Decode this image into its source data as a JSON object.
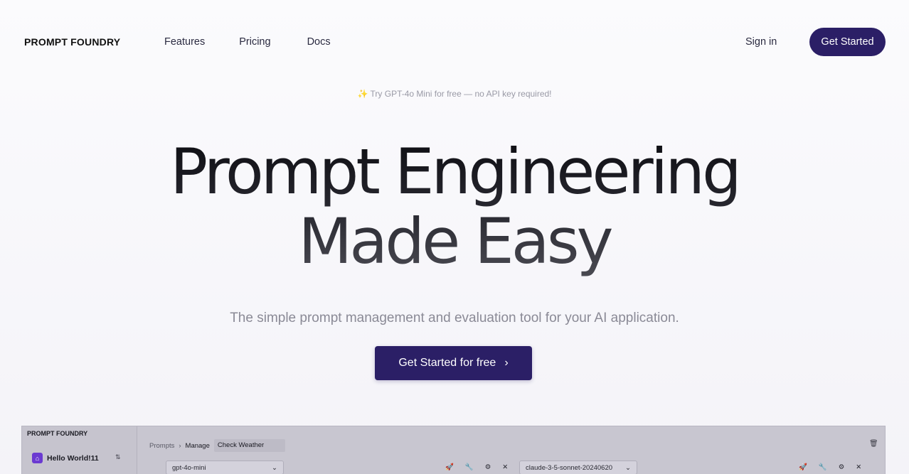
{
  "nav": {
    "brand": "PROMPT FOUNDRY",
    "links": [
      {
        "label": "Features"
      },
      {
        "label": "Pricing"
      },
      {
        "label": "Docs"
      }
    ],
    "sign_in": "Sign in",
    "cta": "Get Started"
  },
  "hero": {
    "promo": "✨ Try GPT-4o Mini for free — no API key required!",
    "headline_line1": "Prompt Engineering",
    "headline_line2": "Made Easy",
    "subhead": "The simple prompt management and evaluation tool for your AI application.",
    "cta": "Get Started for free",
    "cta_icon": "chevron-right-icon"
  },
  "preview": {
    "brand": "PROMPT FOUNDRY",
    "project_name": "Hello World!11",
    "breadcrumb": [
      "Prompts",
      "Manage",
      "Check Weather"
    ],
    "model_left": "gpt-4o-mini",
    "model_right": "claude-3-5-sonnet-20240620",
    "icons": [
      "rocket-icon",
      "wrench-icon",
      "gear-icon",
      "close-icon",
      "trash-icon"
    ]
  },
  "colors": {
    "accent": "#2b1f66",
    "background": "#f7f6fa",
    "muted_text": "#8a8a96"
  }
}
